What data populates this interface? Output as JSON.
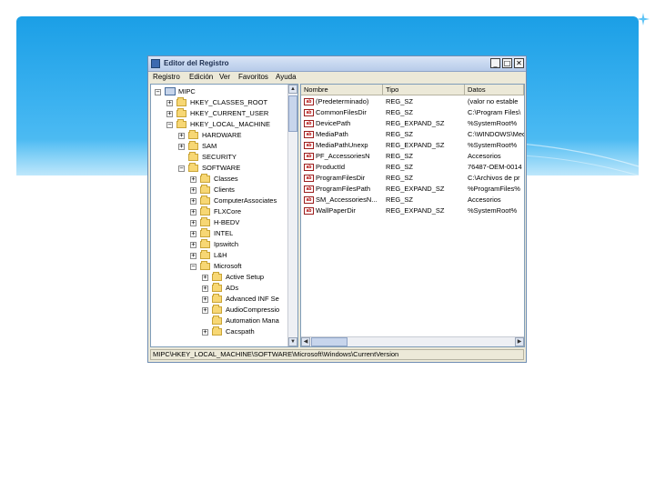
{
  "window": {
    "title": "Editor del Registro",
    "buttons": {
      "minimize": "_",
      "maximize": "□",
      "close": "✕"
    }
  },
  "menu": [
    "Registro",
    "Edición",
    "Ver",
    "Favoritos",
    "Ayuda"
  ],
  "tree": [
    {
      "label": "MIPC",
      "level": 0,
      "expander": "−",
      "icon": "computer-icon"
    },
    {
      "label": "HKEY_CLASSES_ROOT",
      "level": 1,
      "expander": "+",
      "icon": "folder-icon"
    },
    {
      "label": "HKEY_CURRENT_USER",
      "level": 1,
      "expander": "+",
      "icon": "folder-icon"
    },
    {
      "label": "HKEY_LOCAL_MACHINE",
      "level": 1,
      "expander": "−",
      "icon": "folder-icon"
    },
    {
      "label": "HARDWARE",
      "level": 2,
      "expander": "+",
      "icon": "folder-icon"
    },
    {
      "label": "SAM",
      "level": 2,
      "expander": "+",
      "icon": "folder-icon"
    },
    {
      "label": "SECURITY",
      "level": 2,
      "expander": "",
      "icon": "folder-icon"
    },
    {
      "label": "SOFTWARE",
      "level": 2,
      "expander": "−",
      "icon": "folder-icon"
    },
    {
      "label": "Classes",
      "level": 3,
      "expander": "+",
      "icon": "folder-icon"
    },
    {
      "label": "Clients",
      "level": 3,
      "expander": "+",
      "icon": "folder-icon"
    },
    {
      "label": "ComputerAssociates",
      "level": 3,
      "expander": "+",
      "icon": "folder-icon"
    },
    {
      "label": "FLXCore",
      "level": 3,
      "expander": "+",
      "icon": "folder-icon"
    },
    {
      "label": "H-BEDV",
      "level": 3,
      "expander": "+",
      "icon": "folder-icon"
    },
    {
      "label": "INTEL",
      "level": 3,
      "expander": "+",
      "icon": "folder-icon"
    },
    {
      "label": "Ipswitch",
      "level": 3,
      "expander": "+",
      "icon": "folder-icon"
    },
    {
      "label": "L&H",
      "level": 3,
      "expander": "+",
      "icon": "folder-icon"
    },
    {
      "label": "Microsoft",
      "level": 3,
      "expander": "−",
      "icon": "folder-icon"
    },
    {
      "label": "Active Setup",
      "level": 4,
      "expander": "+",
      "icon": "folder-icon"
    },
    {
      "label": "ADs",
      "level": 4,
      "expander": "+",
      "icon": "folder-icon"
    },
    {
      "label": "Advanced INF Se",
      "level": 4,
      "expander": "+",
      "icon": "folder-icon"
    },
    {
      "label": "AudioCompressio",
      "level": 4,
      "expander": "+",
      "icon": "folder-icon"
    },
    {
      "label": "Automation Mana",
      "level": 4,
      "expander": "",
      "icon": "folder-icon"
    },
    {
      "label": "Cacspath",
      "level": 4,
      "expander": "+",
      "icon": "folder-icon"
    }
  ],
  "columns": {
    "name": "Nombre",
    "type": "Tipo",
    "data": "Datos"
  },
  "values": [
    {
      "name": "(Predeterminado)",
      "type": "REG_SZ",
      "data": "(valor no estable"
    },
    {
      "name": "CommonFilesDir",
      "type": "REG_SZ",
      "data": "C:\\Program Files\\"
    },
    {
      "name": "DevicePath",
      "type": "REG_EXPAND_SZ",
      "data": "%SystemRoot%"
    },
    {
      "name": "MediaPath",
      "type": "REG_SZ",
      "data": "C:\\WINDOWS\\Medi"
    },
    {
      "name": "MediaPathUnexp",
      "type": "REG_EXPAND_SZ",
      "data": "%SystemRoot%"
    },
    {
      "name": "PF_AccessoriesN",
      "type": "REG_SZ",
      "data": "Accesorios"
    },
    {
      "name": "ProductId",
      "type": "REG_SZ",
      "data": "76487-OEM-0014"
    },
    {
      "name": "ProgramFilesDir",
      "type": "REG_SZ",
      "data": "C:\\Archivos de pr"
    },
    {
      "name": "ProgramFilesPath",
      "type": "REG_EXPAND_SZ",
      "data": "%ProgramFiles%"
    },
    {
      "name": "SM_AccessoriesN...",
      "type": "REG_SZ",
      "data": "Accesorios"
    },
    {
      "name": "WallPaperDir",
      "type": "REG_EXPAND_SZ",
      "data": "%SystemRoot%"
    }
  ],
  "status": "MIPC\\HKEY_LOCAL_MACHINE\\SOFTWARE\\Microsoft\\Windows\\CurrentVersion",
  "colors": {
    "banner": "#1b9fe6",
    "titlebar": "#c6d7f0",
    "folder": "#f7d774"
  }
}
